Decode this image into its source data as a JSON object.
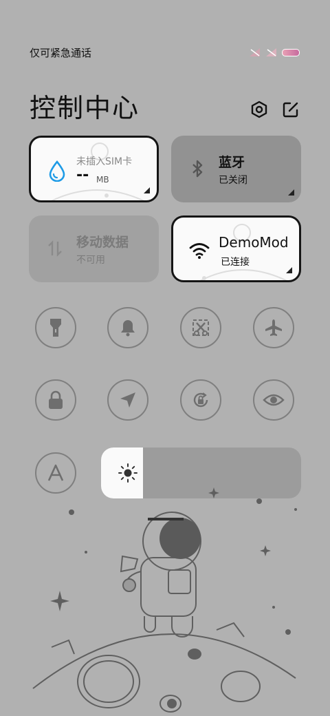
{
  "status": {
    "carrier_text": "仅可紧急通话"
  },
  "header": {
    "title": "控制中心",
    "settings_icon": "gear-icon",
    "edit_icon": "edit-icon"
  },
  "tiles": {
    "data_usage": {
      "title": "未插入SIM卡",
      "value": "--",
      "unit": "MB",
      "state": "active"
    },
    "bluetooth": {
      "title": "蓝牙",
      "status": "已关闭",
      "state": "off"
    },
    "mobile_data": {
      "title": "移动数据",
      "status": "不可用",
      "state": "disabled"
    },
    "wifi": {
      "title": "DemoMod",
      "status": "已连接",
      "state": "active"
    }
  },
  "toggles": [
    {
      "name": "flashlight",
      "icon": "flashlight-icon"
    },
    {
      "name": "ringer",
      "icon": "bell-icon"
    },
    {
      "name": "screenshot",
      "icon": "scissors-icon"
    },
    {
      "name": "airplane-mode",
      "icon": "airplane-icon"
    },
    {
      "name": "lock-screen",
      "icon": "lock-icon"
    },
    {
      "name": "location",
      "icon": "location-arrow-icon"
    },
    {
      "name": "rotation-lock",
      "icon": "rotation-lock-icon"
    },
    {
      "name": "reading-mode",
      "icon": "eye-icon"
    },
    {
      "name": "auto-brightness",
      "icon": "letter-a-icon"
    }
  ],
  "brightness": {
    "level_percent": 21
  },
  "colors": {
    "background": "#b1b1b1",
    "tile_active": "#fafafa",
    "tile_inactive": "#929292",
    "accent_blue": "#1e9be6"
  }
}
